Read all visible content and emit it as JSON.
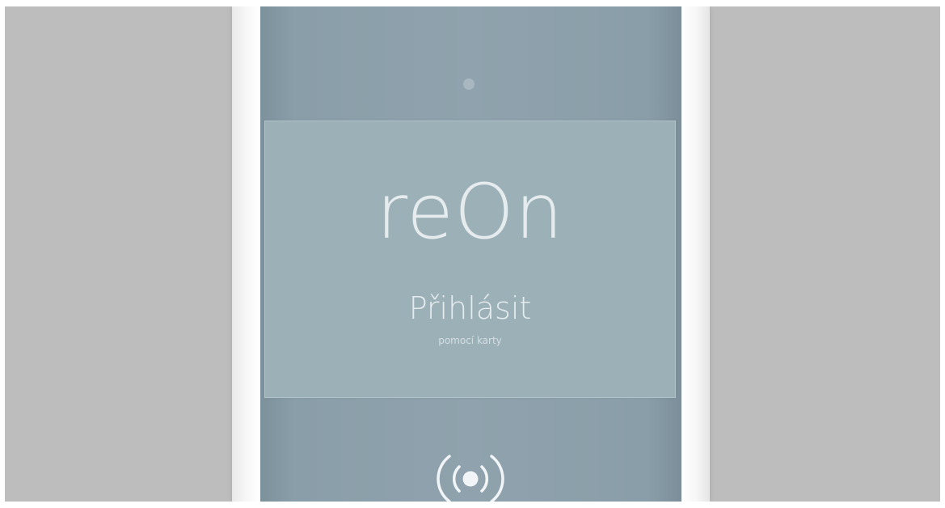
{
  "app": {
    "logo_text": "reOn",
    "login": {
      "title": "Přihlásit",
      "subtitle": "pomocí karty"
    },
    "icons": {
      "status": "camera-dot-icon",
      "reader": "nfc-icon"
    }
  },
  "colors": {
    "backdrop": "#bdbdbd",
    "device_frame": "#ffffff",
    "screen": "#8fa2ad",
    "card": "#9cb0b8",
    "text": "#e6ecee"
  }
}
